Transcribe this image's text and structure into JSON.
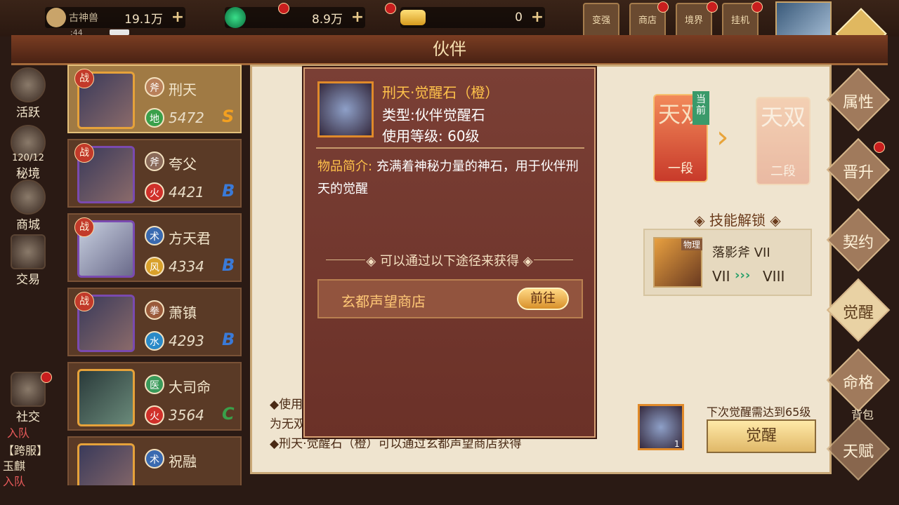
{
  "topbar": {
    "res1": {
      "label": "古神兽",
      "time": ":44",
      "value": "19.1万"
    },
    "res2": {
      "value": "8.9万"
    },
    "res3": {
      "value": "0"
    },
    "icons": [
      {
        "label": "变强"
      },
      {
        "label": "商店"
      },
      {
        "label": "境界"
      },
      {
        "label": "挂机"
      }
    ]
  },
  "title": "伙伴",
  "sidenav": {
    "items": [
      {
        "label": "活跃"
      },
      {
        "label": "秘境",
        "count": "120/12"
      },
      {
        "label": "商城"
      },
      {
        "label": "交易"
      },
      {
        "label": "社交"
      }
    ],
    "join_team": "入队",
    "chat_lines": [
      "【跨服】",
      "玉麒",
      "入队"
    ]
  },
  "partners": [
    {
      "name": "刑天",
      "class_icon": "斧",
      "element": "地",
      "power": "5472",
      "grade": "S",
      "selected": true,
      "battle": "战"
    },
    {
      "name": "夸父",
      "class_icon": "斧",
      "element": "火",
      "power": "4421",
      "grade": "B",
      "selected": false,
      "battle": "战"
    },
    {
      "name": "方天君",
      "class_icon": "术",
      "element": "风",
      "power": "4334",
      "grade": "B",
      "selected": false,
      "battle": "战"
    },
    {
      "name": "萧镇",
      "class_icon": "拳",
      "element": "水",
      "power": "4293",
      "grade": "B",
      "selected": false,
      "battle": "战"
    },
    {
      "name": "大司命",
      "class_icon": "医",
      "element": "火",
      "power": "3564",
      "grade": "C",
      "selected": false,
      "battle": ""
    },
    {
      "name": "祝融",
      "class_icon": "术",
      "element": "",
      "power": "",
      "grade": "",
      "selected": false,
      "battle": ""
    }
  ],
  "right_tabs": [
    {
      "label": "属性"
    },
    {
      "label": "晋升"
    },
    {
      "label": "契约"
    },
    {
      "label": "觉醒"
    },
    {
      "label": "命格"
    },
    {
      "label": "天赋"
    }
  ],
  "right_extra": {
    "bag_label": "背包"
  },
  "awaken": {
    "current_tag": "当前",
    "current": {
      "title": "天双",
      "stage": "一段"
    },
    "next": {
      "title": "天双",
      "stage": "二段"
    },
    "skill_unlock_title": "技能解锁",
    "skill": {
      "type": "物理",
      "name": "落影斧 VII",
      "from": "VII",
      "to": "VIII"
    },
    "next_requirement": "下次觉醒需达到65级",
    "material_count": "1",
    "awaken_button": "觉醒",
    "notes": [
      "◆使用",
      "为无双",
      "◆刑天·觉醒石（橙）可以通过玄都声望商店获得"
    ]
  },
  "popup": {
    "item_name": "刑天·觉醒石（橙）",
    "type_line": "类型:伙伴觉醒石",
    "level_line": "使用等级: 60级",
    "desc_label": "物品简介:",
    "desc_text": "充满着神秘力量的神石，用于伙伴刑天的觉醒",
    "obtain_title": "可以通过以下途径来获得",
    "source_name": "玄都声望商店",
    "go_button": "前往"
  },
  "colors": {
    "item_name": "#ffc24a",
    "popup_bg": "#6b3128",
    "panel_bg": "#efe4cf",
    "selected_card": "#a07a44"
  }
}
